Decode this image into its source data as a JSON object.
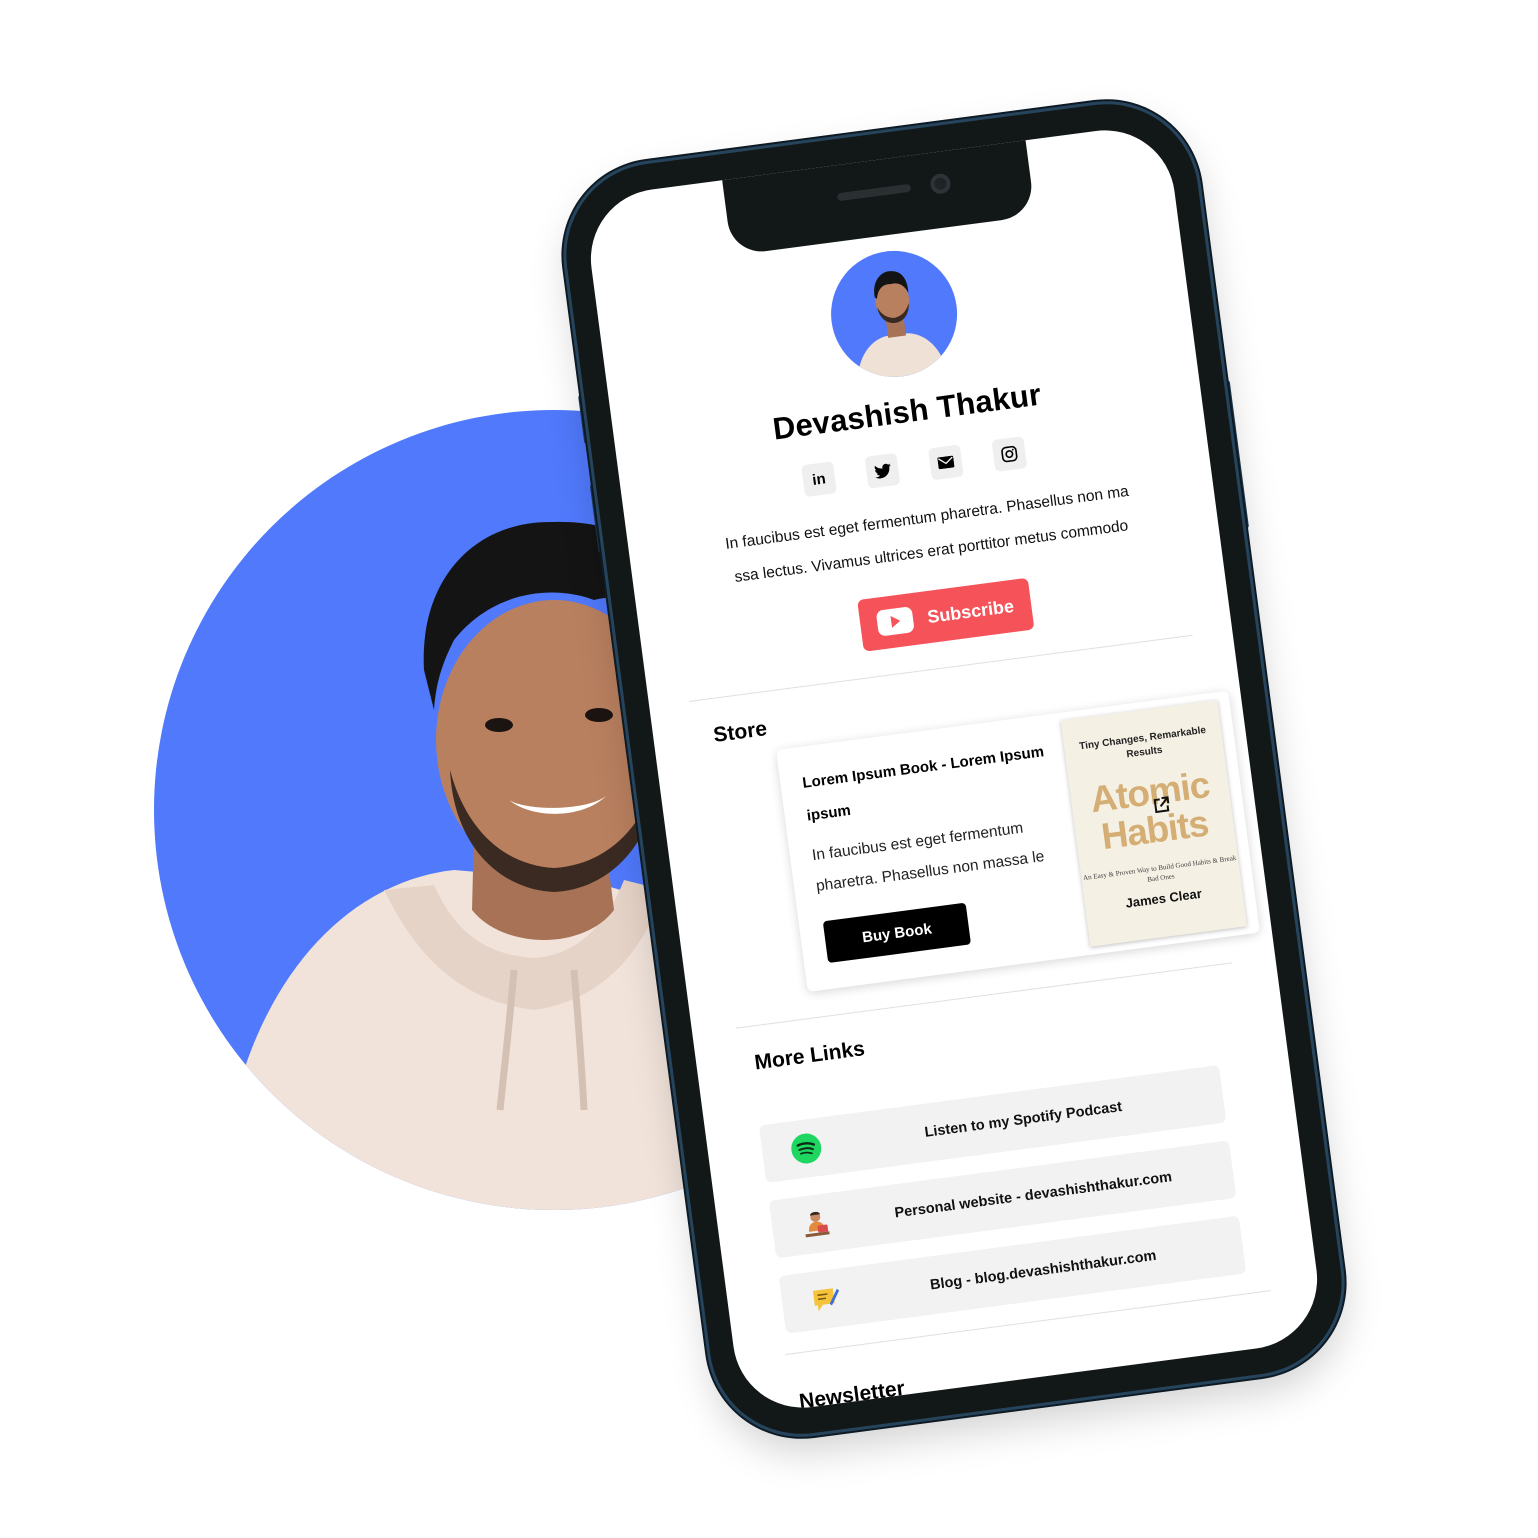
{
  "profile": {
    "name": "Devashish Thakur",
    "bio": "In faucibus est eget fermentum pharetra. Phasellus non ma ssa lectus. Vivamus ultrices erat porttitor metus commodo"
  },
  "socials": [
    {
      "name": "linkedin",
      "label": "in"
    },
    {
      "name": "twitter",
      "label": ""
    },
    {
      "name": "email",
      "label": ""
    },
    {
      "name": "instagram",
      "label": ""
    }
  ],
  "subscribe": {
    "label": "Subscribe",
    "icon": "youtube-icon",
    "color": "#f6525a"
  },
  "store": {
    "title": "Store",
    "product": {
      "title": "Lorem Ipsum Book - Lorem Ipsum ipsum",
      "description": "In faucibus est eget fermentum pharetra. Phasellus non massa le",
      "button": "Buy Book"
    },
    "book_cover": {
      "tagline": "Tiny Changes, Remarkable Results",
      "title": "Atomic Habits",
      "subtitle": "An Easy & Proven Way to Build Good Habits & Break Bad Ones",
      "author": "James Clear"
    }
  },
  "more_links": {
    "title": "More Links",
    "items": [
      {
        "label": "Listen to my Spotify Podcast",
        "icon": "spotify-icon"
      },
      {
        "label": "Personal website - devashishthakur.com",
        "icon": "person-at-desk-icon"
      },
      {
        "label": "Blog - blog.devashishthakur.com",
        "icon": "message-pen-icon"
      }
    ]
  },
  "newsletter": {
    "title": "Newsletter"
  },
  "colors": {
    "accent_blue": "#5079fb",
    "subscribe_red": "#f6525a",
    "phone_frame": "#121818"
  }
}
